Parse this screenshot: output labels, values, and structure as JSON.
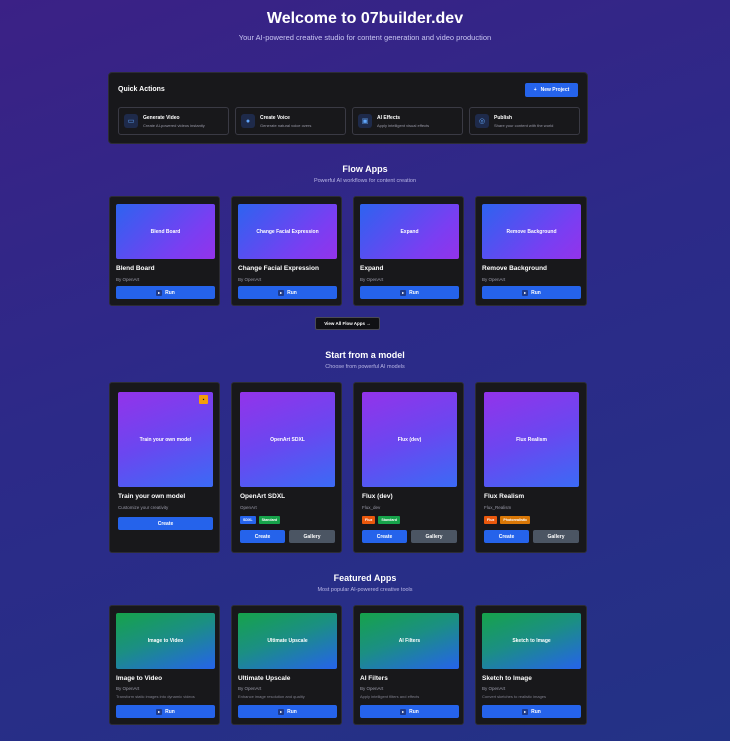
{
  "header": {
    "title": "Welcome to 07builder.dev",
    "subtitle": "Your AI-powered creative studio for content generation and video production"
  },
  "quick_actions": {
    "title": "Quick Actions",
    "new_project": "New Project",
    "items": [
      {
        "name": "Generate Video",
        "desc": "Create AI-powered videos instantly",
        "icon": "video-icon"
      },
      {
        "name": "Create Voice",
        "desc": "Generate natural voice overs",
        "icon": "mic-icon"
      },
      {
        "name": "AI Effects",
        "desc": "Apply intelligent visual effects",
        "icon": "image-icon"
      },
      {
        "name": "Publish",
        "desc": "Share your content with the world",
        "icon": "globe-icon"
      }
    ]
  },
  "flow_apps": {
    "title": "Flow Apps",
    "subtitle": "Powerful AI workflows for content creation",
    "view_all": "View All Flow Apps →",
    "cards": [
      {
        "thumb": "Blend Board",
        "name": "Blend Board",
        "by": "By OpenArt",
        "button": "Run"
      },
      {
        "thumb": "Change Facial Expression",
        "name": "Change Facial Expression",
        "by": "By OpenArt",
        "button": "Run"
      },
      {
        "thumb": "Expand",
        "name": "Expand",
        "by": "By OpenArt",
        "button": "Run"
      },
      {
        "thumb": "Remove Background",
        "name": "Remove Background",
        "by": "By OpenArt",
        "button": "Run"
      }
    ]
  },
  "models": {
    "title": "Start from a model",
    "subtitle": "Choose from powerful AI models",
    "cards": [
      {
        "thumb": "Train your own model",
        "name": "Train your own model",
        "by": "Customize your creativity",
        "create": "Create"
      },
      {
        "thumb": "OpenArt SDXL",
        "name": "OpenArt SDXL",
        "by": "OpenArt",
        "tags": [
          "SDXL",
          "Standard"
        ],
        "create": "Create",
        "gallery": "Gallery"
      },
      {
        "thumb": "Flux (dev)",
        "name": "Flux (dev)",
        "by": "Flux_dev",
        "tags": [
          "Flux",
          "Standard"
        ],
        "create": "Create",
        "gallery": "Gallery"
      },
      {
        "thumb": "Flux Realism",
        "name": "Flux Realism",
        "by": "Flux_Realism",
        "tags": [
          "Flux",
          "Photorealistic"
        ],
        "create": "Create",
        "gallery": "Gallery"
      }
    ]
  },
  "featured": {
    "title": "Featured Apps",
    "subtitle": "Most popular AI-powered creative tools",
    "cards": [
      {
        "thumb": "Image to Video",
        "name": "Image to Video",
        "by": "By OpenArt",
        "desc": "Transform static images into dynamic videos",
        "button": "Run"
      },
      {
        "thumb": "Ultimate Upscale",
        "name": "Ultimate Upscale",
        "by": "By OpenArt",
        "desc": "Enhance image resolution and quality",
        "button": "Run"
      },
      {
        "thumb": "AI Filters",
        "name": "AI Filters",
        "by": "By OpenArt",
        "desc": "Apply intelligent filters and effects",
        "button": "Run"
      },
      {
        "thumb": "Sketch to Image",
        "name": "Sketch to Image",
        "by": "By OpenArt",
        "desc": "Convert sketches to realistic images",
        "button": "Run"
      }
    ]
  },
  "colors": {
    "accent": "#2563eb",
    "card_bg": "#18181b",
    "tag_blue": "#2563eb",
    "tag_green": "#16a34a",
    "tag_orange": "#ea580c",
    "tag_amber": "#d97706"
  }
}
